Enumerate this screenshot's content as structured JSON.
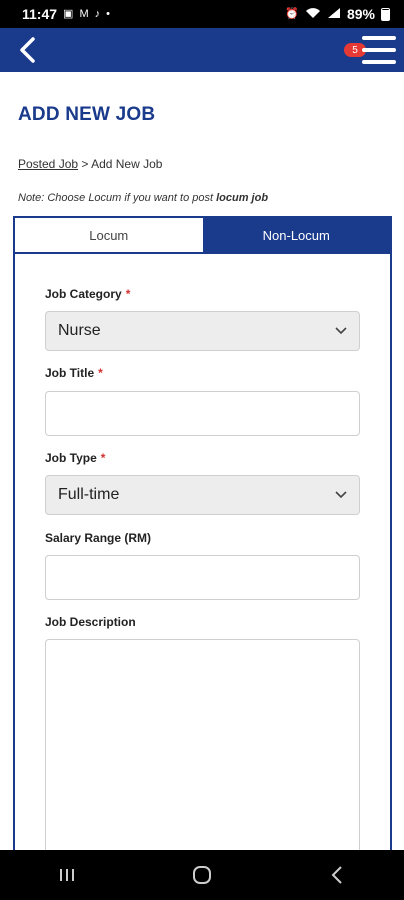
{
  "status_bar": {
    "time": "11:47",
    "battery": "89%"
  },
  "header": {
    "notification_count": "5"
  },
  "page": {
    "title": "ADD NEW JOB",
    "breadcrumb": {
      "link": "Posted Job",
      "separator": " > ",
      "current": "Add New Job"
    },
    "note": {
      "prefix": "Note: Choose Locum if you want to post ",
      "emphasis": "locum job"
    }
  },
  "tabs": [
    {
      "label": "Locum",
      "active": false
    },
    {
      "label": "Non-Locum",
      "active": true
    }
  ],
  "form": {
    "job_category": {
      "label": "Job Category",
      "required": "*",
      "value": "Nurse"
    },
    "job_title": {
      "label": "Job Title",
      "required": "*",
      "value": ""
    },
    "job_type": {
      "label": "Job Type",
      "required": "*",
      "value": "Full-time"
    },
    "salary_range": {
      "label": "Salary Range (RM)",
      "value": ""
    },
    "job_description": {
      "label": "Job Description",
      "value": ""
    }
  },
  "colors": {
    "brand": "#1a3a8c",
    "badge": "#e53935",
    "required": "#d32f2f"
  }
}
